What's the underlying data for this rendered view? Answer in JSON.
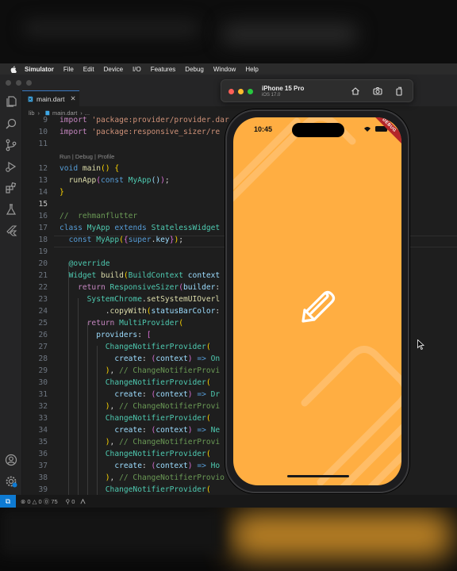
{
  "menubar": {
    "app": "Simulator",
    "items": [
      "File",
      "Edit",
      "Device",
      "I/O",
      "Features",
      "Debug",
      "Window",
      "Help"
    ]
  },
  "editor": {
    "tab_label": "main.dart",
    "tab_close": "✕",
    "breadcrumb": [
      "lib",
      "main.dart",
      "..."
    ],
    "codelens": "Run | Debug | Profile",
    "lines": [
      {
        "n": "9",
        "code": "import 'package:provider/provider.dart';"
      },
      {
        "n": "10",
        "code": "import 'package:responsive_sizer/responsive_sizer.dart';"
      },
      {
        "n": "11",
        "code": ""
      },
      {
        "n": "12",
        "code": "void main() {"
      },
      {
        "n": "13",
        "code": "  runApp(const MyApp());"
      },
      {
        "n": "14",
        "code": "}"
      },
      {
        "n": "15",
        "code": ""
      },
      {
        "n": "16",
        "code": "//  rehmanflutter"
      },
      {
        "n": "17",
        "code": "class MyApp extends StatelessWidget {"
      },
      {
        "n": "18",
        "code": "  const MyApp({super.key});"
      },
      {
        "n": "19",
        "code": ""
      },
      {
        "n": "20",
        "code": "  @override"
      },
      {
        "n": "21",
        "code": "  Widget build(BuildContext context) {"
      },
      {
        "n": "22",
        "code": "    return ResponsiveSizer(builder: (context, orientation, screenType) {"
      },
      {
        "n": "23",
        "code": "      SystemChrome.setSystemUIOverlayStyle(SystemUiOverlayStyle.dark"
      },
      {
        "n": "24",
        "code": "          .copyWith(statusBarColor: Colors.transparent));"
      },
      {
        "n": "25",
        "code": "      return MultiProvider("
      },
      {
        "n": "26",
        "code": "        providers: ["
      },
      {
        "n": "27",
        "code": "          ChangeNotifierProvider("
      },
      {
        "n": "28",
        "code": "            create: (context) => On"
      },
      {
        "n": "29",
        "code": "          ), // ChangeNotifierProvi"
      },
      {
        "n": "30",
        "code": "          ChangeNotifierProvider("
      },
      {
        "n": "31",
        "code": "            create: (context) => Dr"
      },
      {
        "n": "32",
        "code": "          ), // ChangeNotifierProvi"
      },
      {
        "n": "33",
        "code": "          ChangeNotifierProvider("
      },
      {
        "n": "34",
        "code": "            create: (context) => Ne"
      },
      {
        "n": "35",
        "code": "          ), // ChangeNotifierProvi"
      },
      {
        "n": "36",
        "code": "          ChangeNotifierProvider("
      },
      {
        "n": "37",
        "code": "            create: (context) => Ho"
      },
      {
        "n": "38",
        "code": "          ), // ChangeNotifierProvi"
      },
      {
        "n": "39",
        "code": "          ChangeNotifierProvider("
      }
    ]
  },
  "statusbar": {
    "remote_icon": "⧉",
    "problems": "⊗ 0 △ 0 ⓪ 75",
    "ports": "⚲ 0"
  },
  "simulator": {
    "device_name": "iPhone 15 Pro",
    "os_version": "iOS 17.0",
    "time": "10:45",
    "debug_banner": "DEBUG",
    "screen_color": "#ffae42"
  },
  "colors": {
    "accent": "#0e7ad2",
    "screen": "#ffae42",
    "debug": "#b4262a"
  }
}
